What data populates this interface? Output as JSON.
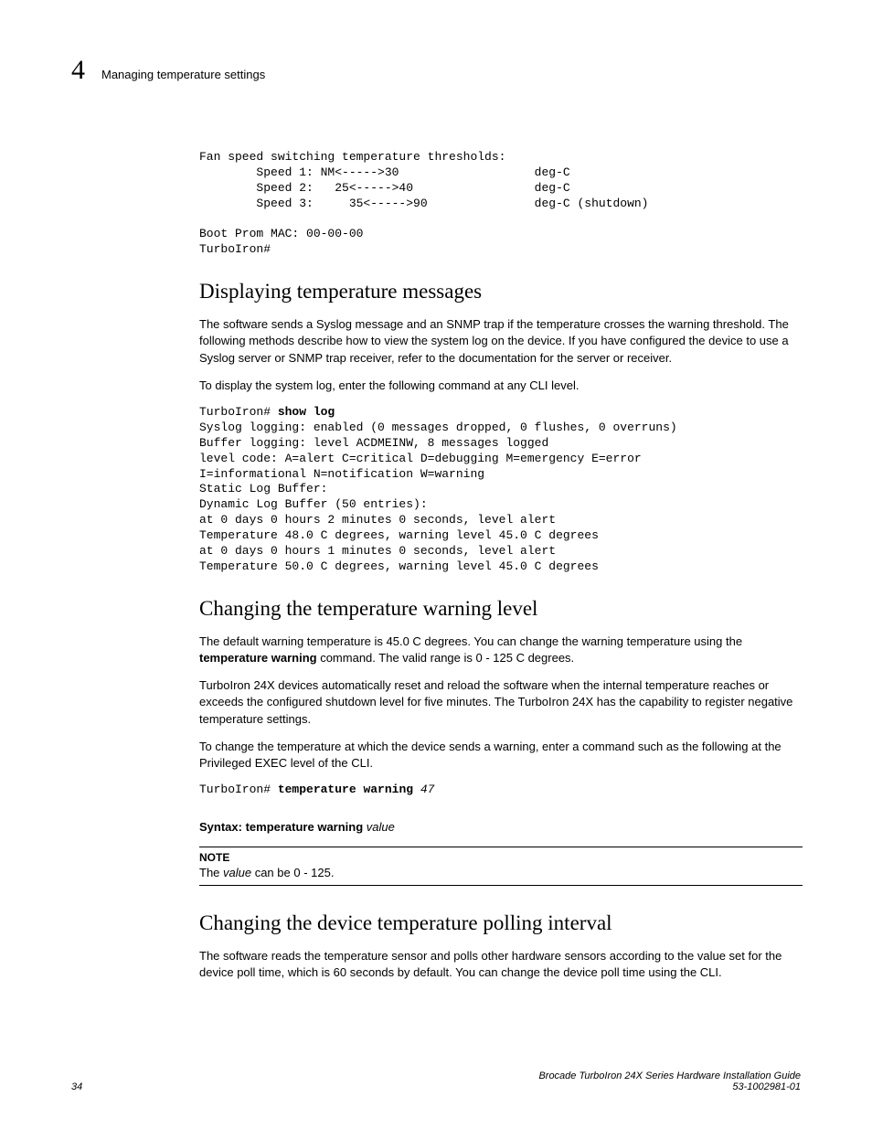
{
  "header": {
    "chapter_number": "4",
    "running_head": "Managing temperature settings"
  },
  "code_thresholds": "Fan speed switching temperature thresholds:\n        Speed 1: NM<----->30                   deg-C\n        Speed 2:   25<----->40                 deg-C\n        Speed 3:     35<----->90               deg-C (shutdown)\n\nBoot Prom MAC: 00-00-00\nTurboIron#",
  "section1": {
    "title": "Displaying temperature messages",
    "p1": "The software sends a Syslog message and an SNMP trap if the temperature crosses the warning threshold. The following methods describe how to view the system log on the device. If you have configured the device to use a Syslog server or SNMP trap receiver, refer to the documentation for the server or receiver.",
    "p2": "To display the system log, enter the following command at any CLI level.",
    "code_prefix": "TurboIron# ",
    "code_cmd": "show log",
    "code_body": "\nSyslog logging: enabled (0 messages dropped, 0 flushes, 0 overruns)\nBuffer logging: level ACDMEINW, 8 messages logged\nlevel code: A=alert C=critical D=debugging M=emergency E=error\nI=informational N=notification W=warning\nStatic Log Buffer:\nDynamic Log Buffer (50 entries):\nat 0 days 0 hours 2 minutes 0 seconds, level alert\nTemperature 48.0 C degrees, warning level 45.0 C degrees\nat 0 days 0 hours 1 minutes 0 seconds, level alert\nTemperature 50.0 C degrees, warning level 45.0 C degrees"
  },
  "section2": {
    "title": "Changing the temperature warning level",
    "p1a": "The default warning temperature is 45.0 C degrees. You can change the warning temperature using the ",
    "p1b": "temperature warning",
    "p1c": " command. The valid range is 0 - 125 C degrees.",
    "p2": "TurboIron 24X devices automatically reset and reload the software when the internal temperature reaches or exceeds the configured shutdown level for five minutes. The TurboIron 24X has the capability to register negative temperature settings.",
    "p3": "To change the temperature at which the device sends a warning, enter a command such as the following at the Privileged EXEC level of the CLI.",
    "code_prefix": "TurboIron# ",
    "code_cmd": "temperature warning ",
    "code_arg": "47",
    "syntax_label": "Syntax:  ",
    "syntax_cmd": "temperature warning ",
    "syntax_arg": "value",
    "note_label": "NOTE",
    "note_a": "The ",
    "note_b": "value",
    "note_c": " can be 0 - 125."
  },
  "section3": {
    "title": "Changing the device temperature polling interval",
    "p1": "The software reads the temperature sensor and polls other hardware sensors according to the value set for the device poll time, which is 60 seconds by default. You can change the device poll time using the CLI."
  },
  "footer": {
    "page_number": "34",
    "doc_title": "Brocade TurboIron 24X Series Hardware Installation Guide",
    "doc_id": "53-1002981-01"
  }
}
